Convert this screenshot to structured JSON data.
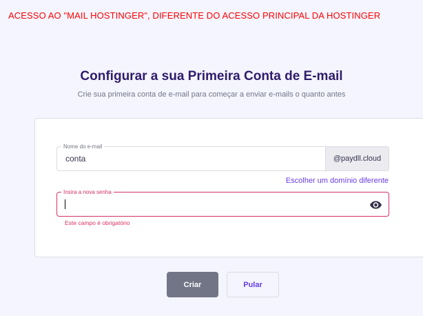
{
  "annotation": "ACESSO AO \"MAIL HOSTINGER\", DIFERENTE DO ACESSO PRINCIPAL DA HOSTINGER",
  "header": {
    "title": "Configurar a sua Primeira Conta de E-mail",
    "subtitle": "Crie sua primeira conta de e-mail para começar a enviar e-mails o quanto antes"
  },
  "form": {
    "email": {
      "label": "Nome do e-mail",
      "value": "conta",
      "domain": "@paydll.cloud"
    },
    "choose_domain_label": "Escolher um domínio diferente",
    "password": {
      "label": "Insira a nova senha",
      "value": "",
      "error": "Este campo é obrigatório",
      "toggle_icon": "eye-icon"
    }
  },
  "actions": {
    "create_label": "Criar",
    "skip_label": "Pular"
  },
  "colors": {
    "annotation": "#ff0000",
    "title": "#2f1c6a",
    "accent": "#673de6",
    "error": "#d63163",
    "disabled_button": "#727586"
  }
}
